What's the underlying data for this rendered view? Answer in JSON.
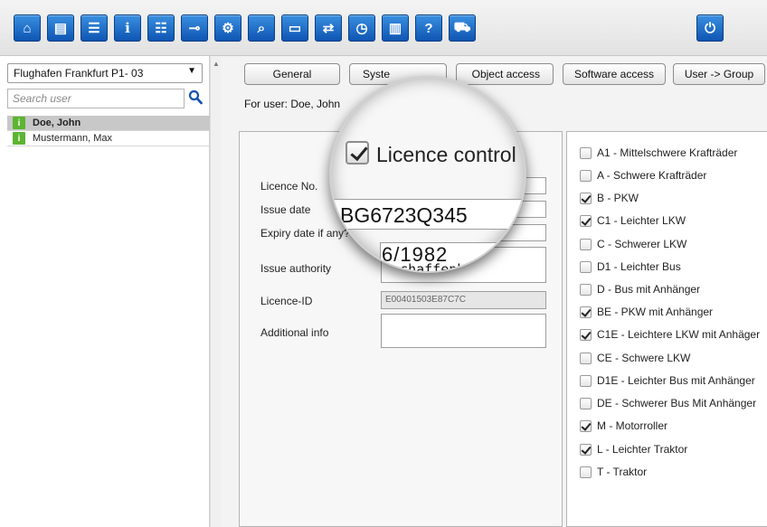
{
  "toolbar": {
    "buttons": [
      {
        "icon": "home-icon",
        "glyph": "⌂"
      },
      {
        "icon": "document-icon",
        "glyph": "▤"
      },
      {
        "icon": "server-icon",
        "glyph": "☰"
      },
      {
        "icon": "info-icon",
        "glyph": "i"
      },
      {
        "icon": "group-icon",
        "glyph": "☷"
      },
      {
        "icon": "key-icon",
        "glyph": "⊸"
      },
      {
        "icon": "settings-tree-icon",
        "glyph": "⚙"
      },
      {
        "icon": "search-person-icon",
        "glyph": "⌕"
      },
      {
        "icon": "monitor-icon",
        "glyph": "▭"
      },
      {
        "icon": "transfer-icon",
        "glyph": "⇄"
      },
      {
        "icon": "clock-icon",
        "glyph": "◷"
      },
      {
        "icon": "report-chart-icon",
        "glyph": "▥"
      },
      {
        "icon": "help-icon",
        "glyph": "?"
      },
      {
        "icon": "vehicle-icon",
        "glyph": "⛟"
      },
      {
        "icon": "power-icon",
        "glyph": "⏻"
      }
    ]
  },
  "sidebar": {
    "site": "Flughafen Frankfurt P1- 03",
    "search_placeholder": "Search user",
    "users": [
      {
        "name": "Doe, John",
        "selected": true
      },
      {
        "name": "Mustermann, Max",
        "selected": false
      }
    ]
  },
  "tabs": [
    "General",
    "Syste",
    "Object access",
    "Software access",
    "User -> Group"
  ],
  "for_user": "For user: Doe, John",
  "form": {
    "licence_no_label": "Licence No.",
    "issue_date_label": "Issue date",
    "expiry_label": "Expiry date if any?",
    "authority_label": "Issue authority",
    "licence_id_label": "Licence-ID",
    "licence_id_value": "E00401503E87C7C",
    "additional_label": "Additional info"
  },
  "magnifier": {
    "licence_control_label": "Licence control",
    "licence_no_value": "BG6723Q345",
    "issue_date_partial": "6/1982",
    "authority_value": "Aschaffenburg"
  },
  "licence_classes": [
    {
      "label": "A1 - Mittelschwere Krafträder",
      "checked": false
    },
    {
      "label": "A - Schwere Krafträder",
      "checked": false
    },
    {
      "label": "B - PKW",
      "checked": true
    },
    {
      "label": "C1 - Leichter LKW",
      "checked": true
    },
    {
      "label": "C - Schwerer LKW",
      "checked": false
    },
    {
      "label": "D1 - Leichter Bus",
      "checked": false
    },
    {
      "label": "D - Bus mit Anhänger",
      "checked": false
    },
    {
      "label": "BE - PKW mit Anhänger",
      "checked": true
    },
    {
      "label": "C1E - Leichtere LKW mit Anhäger",
      "checked": true
    },
    {
      "label": "CE - Schwere LKW",
      "checked": false
    },
    {
      "label": "D1E - Leichter Bus mit Anhänger",
      "checked": false
    },
    {
      "label": "DE - Schwerer Bus Mit Anhänger",
      "checked": false
    },
    {
      "label": "M - Motorroller",
      "checked": true
    },
    {
      "label": "L - Leichter Traktor",
      "checked": true
    },
    {
      "label": "T - Traktor",
      "checked": false
    }
  ],
  "colors": {
    "toolbar_button": "#1d6fd0",
    "user_icon": "#5cb531"
  }
}
